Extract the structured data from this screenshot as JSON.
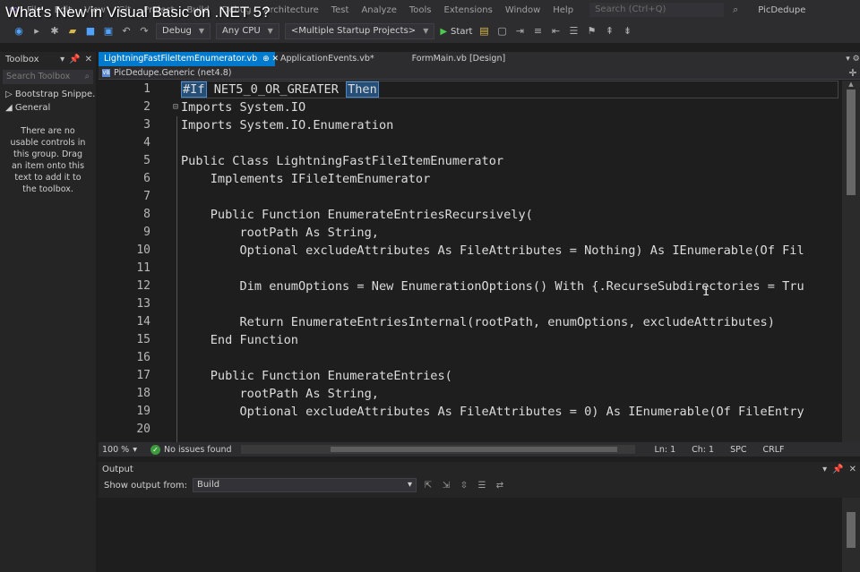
{
  "video_title": "What's New in Visual Basic on .NET 5?",
  "menu": {
    "items": [
      "File",
      "Edit",
      "View",
      "Git",
      "Project",
      "Build",
      "Debug",
      "Architecture",
      "Test",
      "Analyze",
      "Tools",
      "Extensions",
      "Window",
      "Help"
    ],
    "search_placeholder": "Search (Ctrl+Q)",
    "solution_name": "PicDedupe"
  },
  "toolbar": {
    "config": "Debug",
    "platform": "Any CPU",
    "startup": "<Multiple Startup Projects>",
    "start_label": "Start"
  },
  "toolbox": {
    "title": "Toolbox",
    "search_placeholder": "Search Toolbox",
    "groups": [
      "Bootstrap Snippe...",
      "General"
    ],
    "empty_message": "There are no usable controls in this group. Drag an item onto this text to add it to the toolbox."
  },
  "tabs": [
    {
      "label": "LightningFastFileItemEnumerator.vb",
      "active": true
    },
    {
      "label": "ApplicationEvents.vb*",
      "active": false
    },
    {
      "label": "FormMain.vb [Design]",
      "active": false
    }
  ],
  "navbar": {
    "project": "PicDedupe.Generic (net4.8)"
  },
  "code": {
    "line_numbers": [
      "1",
      "2",
      "3",
      "4",
      "5",
      "6",
      "7",
      "8",
      "9",
      "10",
      "11",
      "12",
      "13",
      "14",
      "15",
      "16",
      "17",
      "18",
      "19",
      "20"
    ],
    "line1_directive": "#If",
    "line1_symbol": " NET5_0_OR_GREATER ",
    "line1_then": "Then",
    "lines": [
      "",
      "Imports System.IO",
      "Imports System.IO.Enumeration",
      "",
      "Public Class LightningFastFileItemEnumerator",
      "    Implements IFileItemEnumerator",
      "",
      "    Public Function EnumerateEntriesRecursively(",
      "        rootPath As String,",
      "        Optional excludeAttributes As FileAttributes = Nothing) As IEnumerable(Of Fil",
      "",
      "        Dim enumOptions = New EnumerationOptions() With {.RecurseSubdirectories = Tru",
      "",
      "        Return EnumerateEntriesInternal(rootPath, enumOptions, excludeAttributes)",
      "    End Function",
      "",
      "    Public Function EnumerateEntries(",
      "        rootPath As String,",
      "        Optional excludeAttributes As FileAttributes = 0) As IEnumerable(Of FileEntry",
      ""
    ]
  },
  "status": {
    "zoom": "100 %",
    "issues": "No issues found",
    "ln": "Ln: 1",
    "ch": "Ch: 1",
    "spc": "SPC",
    "crlf": "CRLF"
  },
  "output": {
    "title": "Output",
    "show_from_label": "Show output from:",
    "source": "Build"
  }
}
